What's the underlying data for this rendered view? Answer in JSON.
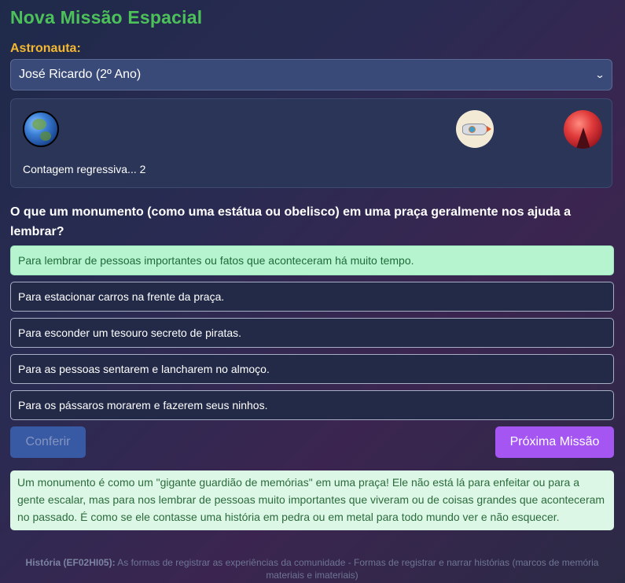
{
  "header": {
    "title": "Nova Missão Espacial"
  },
  "astronaut": {
    "label": "Astronauta:",
    "selected": "José Ricardo (2º Ano)"
  },
  "mission_track": {
    "icons": [
      "earth-icon",
      "rocket-icon",
      "red-planet-icon"
    ],
    "countdown": "Contagem regressiva... 2"
  },
  "quiz": {
    "question": "O que um monumento (como uma estátua ou obelisco) em uma praça geralmente nos ajuda a lembrar?",
    "options": [
      "Para lembrar de pessoas importantes ou fatos que aconteceram há muito tempo.",
      "Para estacionar carros na frente da praça.",
      "Para esconder um tesouro secreto de piratas.",
      "Para as pessoas sentarem e lancharem no almoço.",
      "Para os pássaros morarem e fazerem seus ninhos."
    ],
    "correct_index": 0
  },
  "actions": {
    "check_label": "Conferir",
    "next_label": "Próxima Missão"
  },
  "feedback": {
    "text": "Um monumento é como um \"gigante guardião de memórias\" em uma praça! Ele não está lá para enfeitar ou para a gente escalar, mas para nos lembrar de pessoas muito importantes que viveram ou de coisas grandes que aconteceram no passado. É como se ele contasse uma história em pedra ou em metal para todo mundo ver e não esquecer."
  },
  "footer": {
    "code": "História (EF02HI05):",
    "text": " As formas de registrar as experiências da comunidade - Formas de registrar e narrar histórias (marcos de memória materiais e imateriais)"
  },
  "colors": {
    "title": "#4cc15a",
    "label": "#f4b731",
    "correct_bg": "#b6f4cf",
    "next_button": "#a455f2",
    "check_button": "#3a5fad"
  }
}
